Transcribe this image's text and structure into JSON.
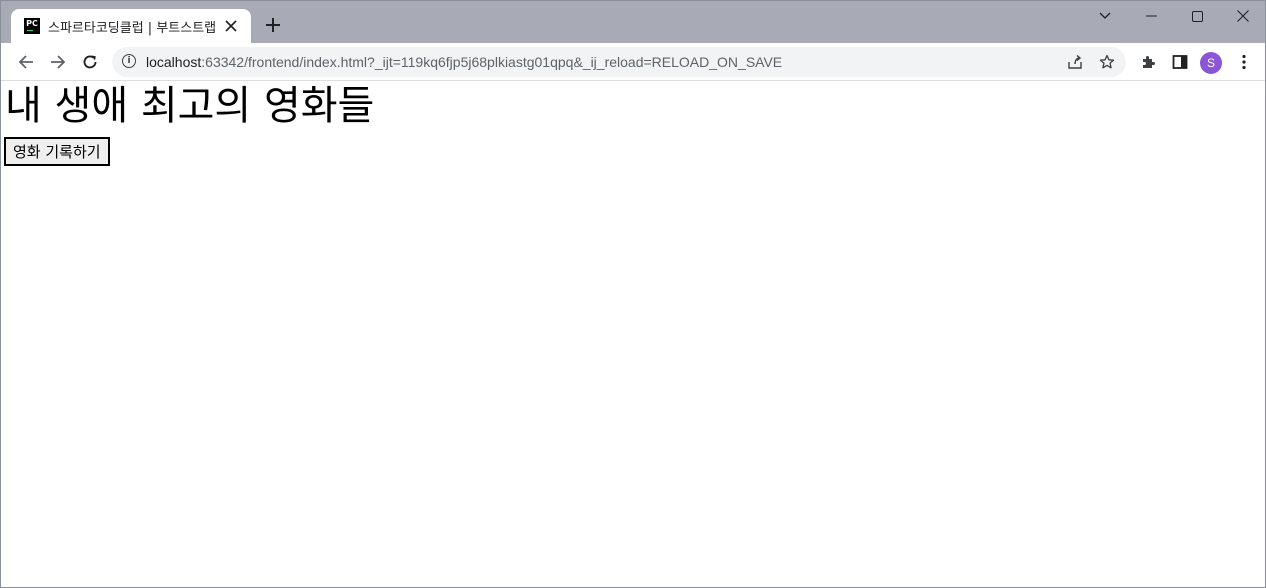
{
  "browser": {
    "tab": {
      "favicon_text": "PC",
      "title": "스파르타코딩클럽 | 부트스트랩"
    },
    "address_bar": {
      "host": "localhost",
      "path": ":63342/frontend/index.html?_ijt=119kq6fjp5j68plkiastg01qpq&_ij_reload=RELOAD_ON_SAVE"
    },
    "profile_initial": "S"
  },
  "page": {
    "heading": "내 생애 최고의 영화들",
    "record_button": "영화 기록하기"
  },
  "colors": {
    "titlebar": "#a8abb6",
    "avatar": "#8a55d6"
  }
}
